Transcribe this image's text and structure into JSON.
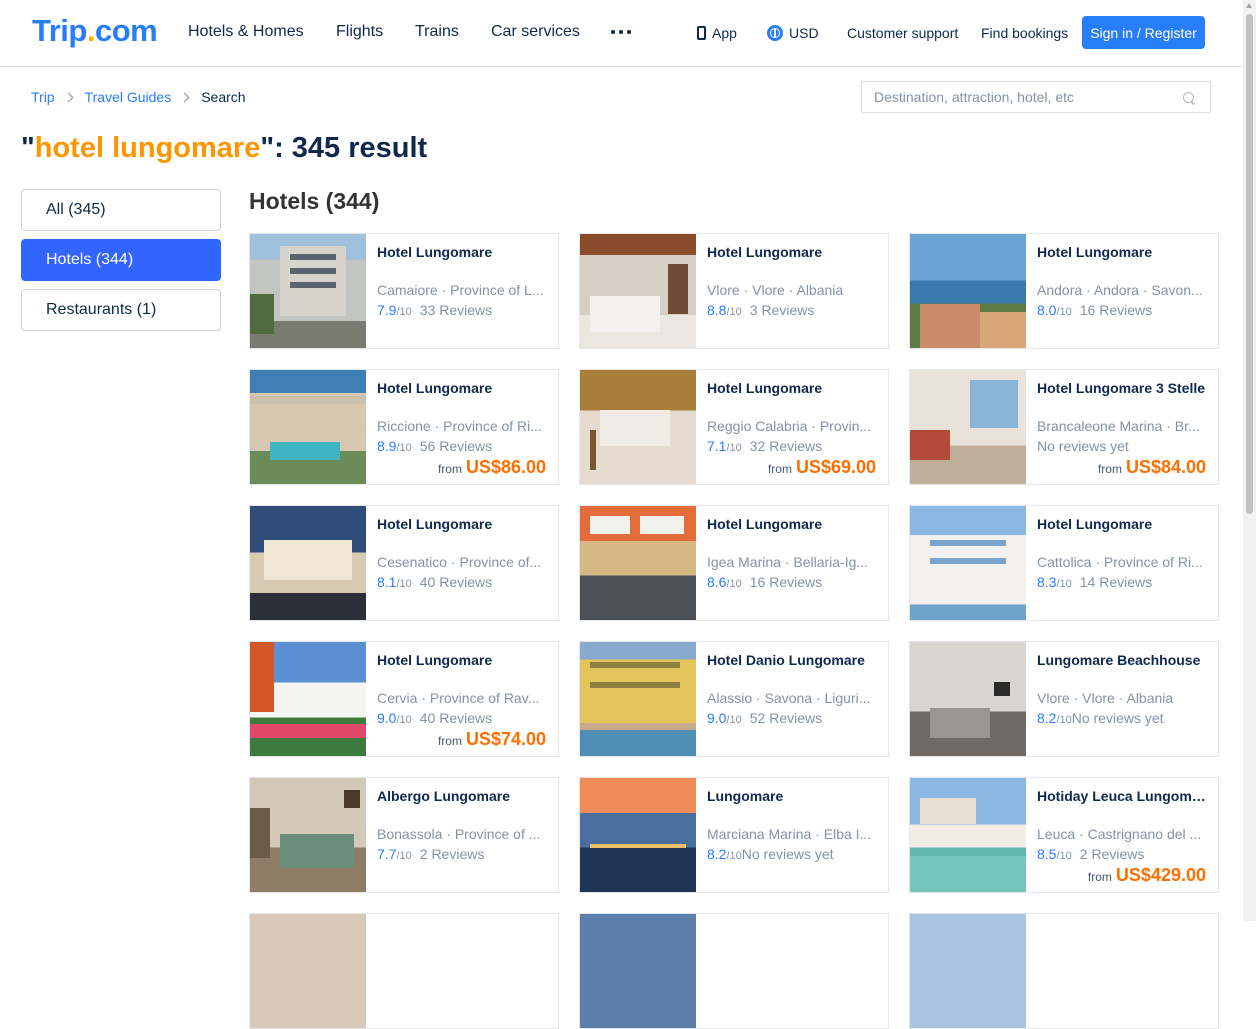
{
  "header": {
    "logo_main": "Trip",
    "logo_dot": ".",
    "logo_tld": "com",
    "nav": [
      "Hotels & Homes",
      "Flights",
      "Trains",
      "Car services"
    ],
    "more_icon": "more-dots-icon",
    "app_label": "App",
    "currency_label": "USD",
    "support_label": "Customer support",
    "bookings_label": "Find bookings",
    "signin_label": "Sign in / Register"
  },
  "breadcrumb": [
    "Trip",
    "Travel Guides",
    "Search"
  ],
  "search": {
    "placeholder": "Destination, attraction, hotel, etc",
    "value": ""
  },
  "title": {
    "open_quote": "\"",
    "keyword": "hotel lungomare",
    "rest": "\": 345 result"
  },
  "filters": [
    "All (345)",
    "Hotels (344)",
    "Restaurants (1)"
  ],
  "active_filter": "Hotels (344)",
  "section_title": "Hotels (344)",
  "colors": {
    "brand_blue": "#287dfa",
    "active_filter": "#3264ff",
    "keyword_orange": "#ff9500",
    "price_orange": "#ff6f00"
  },
  "hotels": [
    {
      "name": "Hotel Lungomare",
      "location": "Camaiore · Province of L...",
      "score": "7.9",
      "scale": "/10",
      "reviews": "33 Reviews",
      "from": "",
      "price": ""
    },
    {
      "name": "Hotel Lungomare",
      "location": "Vlore · Vlore · Albania",
      "score": "8.8",
      "scale": "/10",
      "reviews": "3 Reviews",
      "from": "",
      "price": ""
    },
    {
      "name": "Hotel Lungomare",
      "location": "Andora · Andora · Savon...",
      "score": "8.0",
      "scale": "/10",
      "reviews": "16 Reviews",
      "from": "",
      "price": ""
    },
    {
      "name": "Hotel Lungomare",
      "location": "Riccione · Province of Ri...",
      "score": "8.9",
      "scale": "/10",
      "reviews": "56 Reviews",
      "from": "from",
      "price": "US$86.00"
    },
    {
      "name": "Hotel Lungomare",
      "location": "Reggio Calabria · Provin...",
      "score": "7.1",
      "scale": "/10",
      "reviews": "32 Reviews",
      "from": "from",
      "price": "US$69.00"
    },
    {
      "name": "Hotel Lungomare 3 Stelle",
      "location": "Brancaleone Marina · Br...",
      "score": "",
      "scale": "",
      "reviews": "No reviews yet",
      "from": "from",
      "price": "US$84.00"
    },
    {
      "name": "Hotel Lungomare",
      "location": "Cesenatico · Province of...",
      "score": "8.1",
      "scale": "/10",
      "reviews": "40 Reviews",
      "from": "",
      "price": ""
    },
    {
      "name": "Hotel Lungomare",
      "location": "Igea Marina · Bellaria-Ig...",
      "score": "8.6",
      "scale": "/10",
      "reviews": "16 Reviews",
      "from": "",
      "price": ""
    },
    {
      "name": "Hotel Lungomare",
      "location": "Cattolica · Province of Ri...",
      "score": "8.3",
      "scale": "/10",
      "reviews": "14 Reviews",
      "from": "",
      "price": ""
    },
    {
      "name": "Hotel Lungomare",
      "location": "Cervia · Province of Rav...",
      "score": "9.0",
      "scale": "/10",
      "reviews": "40 Reviews",
      "from": "from",
      "price": "US$74.00"
    },
    {
      "name": "Hotel Danio Lungomare",
      "location": "Alassio · Savona · Liguri...",
      "score": "9.0",
      "scale": "/10",
      "reviews": "52 Reviews",
      "from": "",
      "price": ""
    },
    {
      "name": "Lungomare Beachhouse",
      "location": "Vlore · Vlore · Albania",
      "score": "8.2",
      "scale": "/10",
      "reviews": "No reviews yet",
      "from": "",
      "price": ""
    },
    {
      "name": "Albergo Lungomare",
      "location": "Bonassola · Province of ...",
      "score": "7.7",
      "scale": "/10",
      "reviews": "2 Reviews",
      "from": "",
      "price": ""
    },
    {
      "name": "Lungomare",
      "location": "Marciana Marina · Elba I...",
      "score": "8.2",
      "scale": "/10",
      "reviews": "No reviews yet",
      "from": "",
      "price": ""
    },
    {
      "name": "Hotiday Leuca Lungomare",
      "location": "Leuca · Castrignano del ...",
      "score": "8.5",
      "scale": "/10",
      "reviews": "2 Reviews",
      "from": "from",
      "price": "US$429.00"
    }
  ]
}
